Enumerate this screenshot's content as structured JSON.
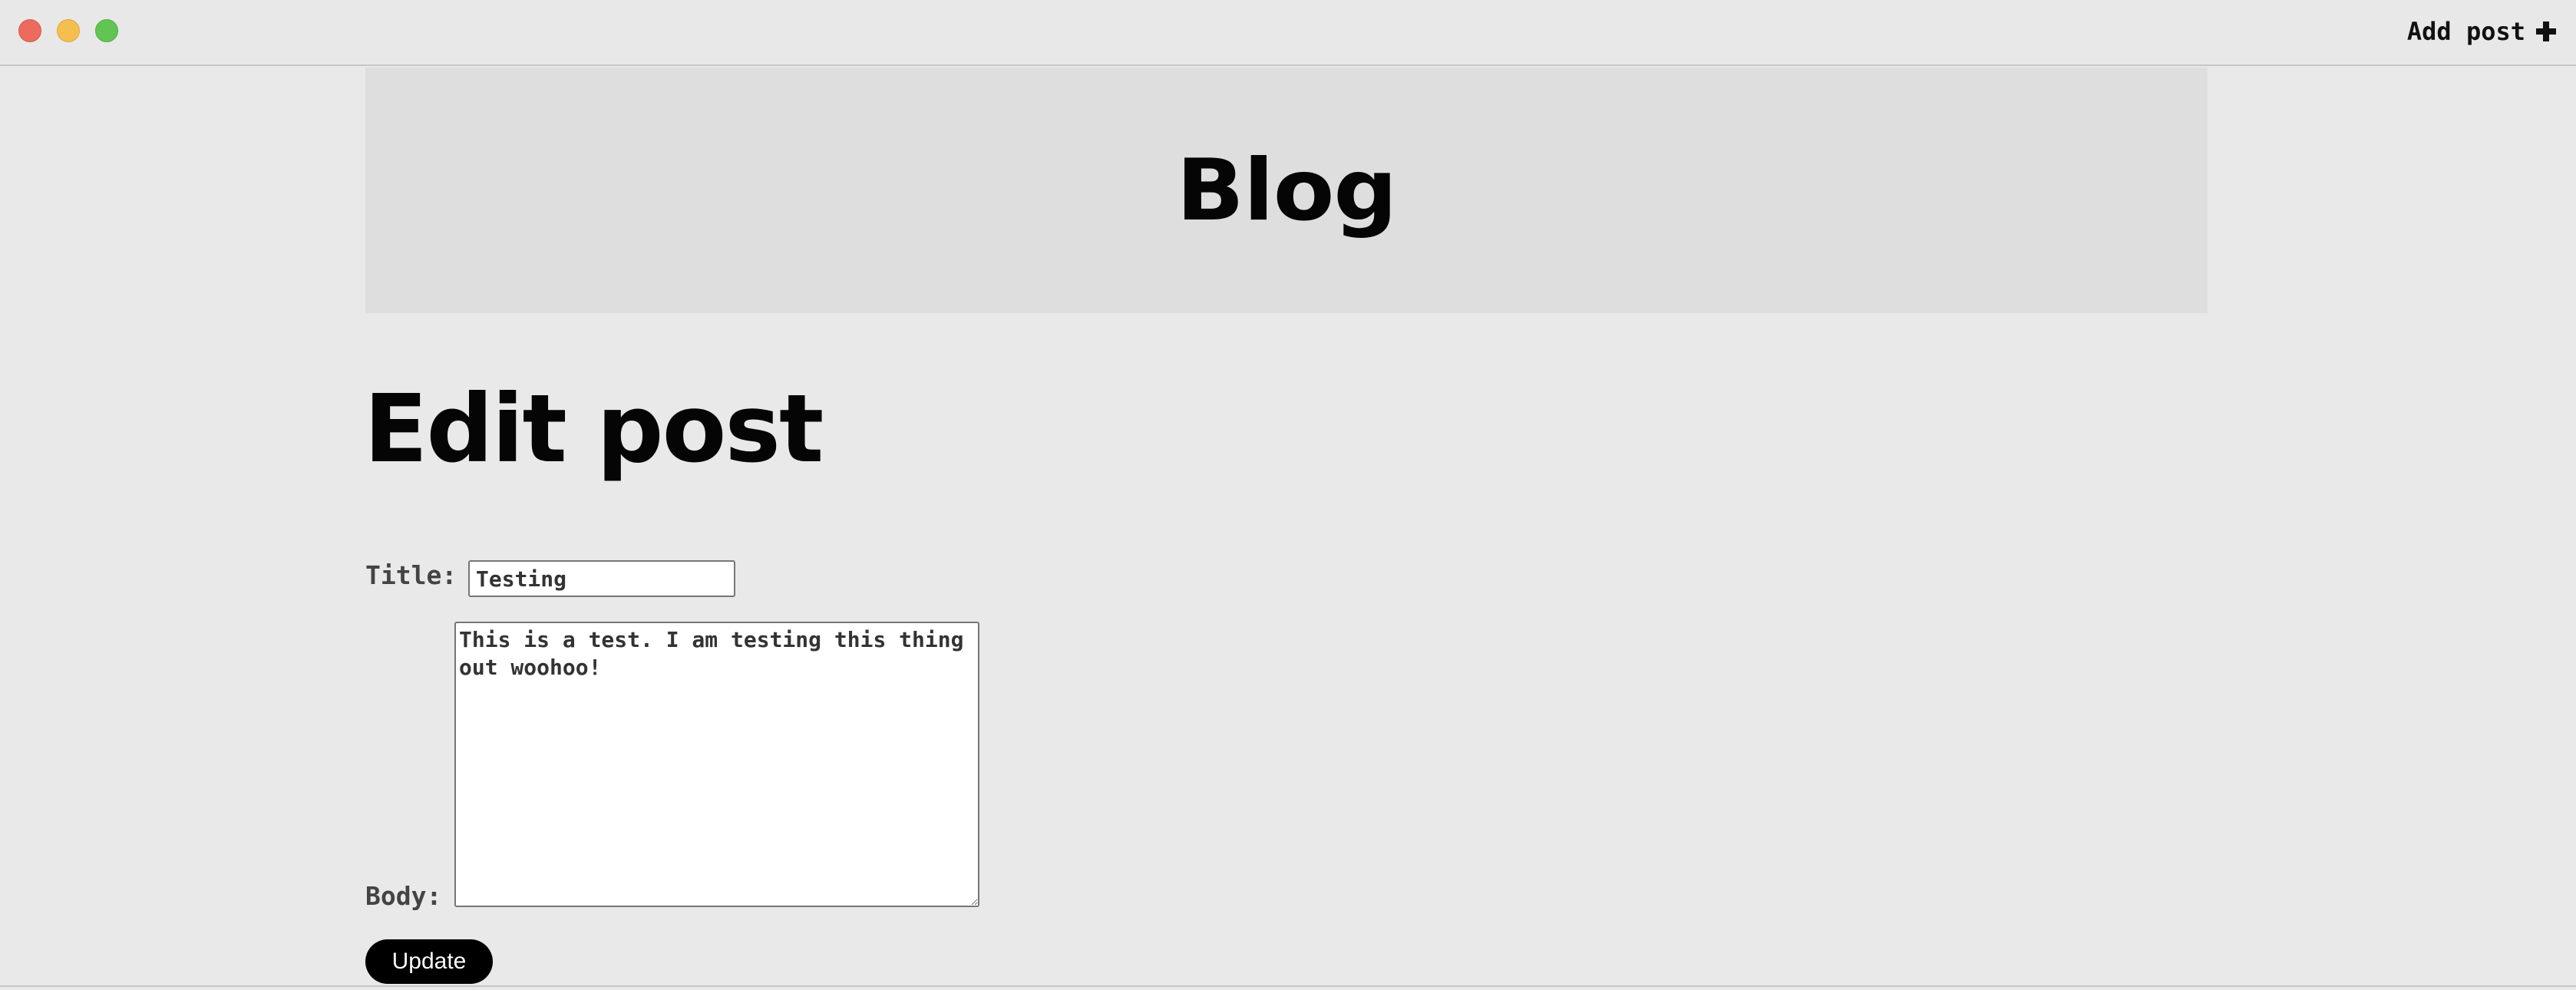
{
  "titlebar": {
    "add_post_label": "Add post",
    "add_post_icon": "plus-icon"
  },
  "banner": {
    "title": "Blog"
  },
  "page": {
    "heading": "Edit post"
  },
  "form": {
    "title_label": "Title:",
    "title_value": "Testing",
    "body_label": "Body:",
    "body_value": "This is a test. I am testing this thing out woohoo!",
    "submit_label": "Update"
  },
  "colors": {
    "background": "#e9e9e9",
    "banner": "#dedede",
    "button": "#000000",
    "close": "#ec6a5e",
    "minimize": "#f4bf4f",
    "maximize": "#61c554"
  }
}
